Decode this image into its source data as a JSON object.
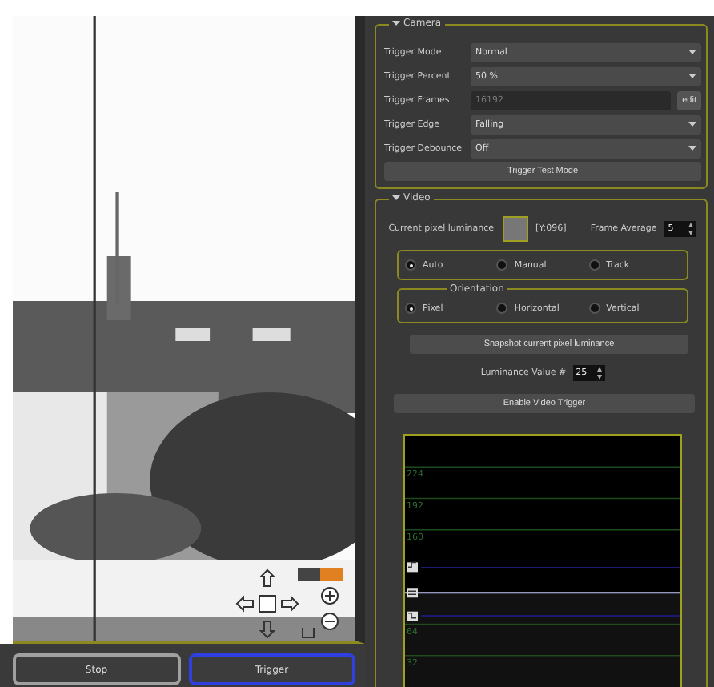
{
  "camera": {
    "title": "Camera",
    "expanded": true,
    "fields": [
      {
        "kind": "combo",
        "label": "Trigger Mode",
        "value": "Normal"
      },
      {
        "kind": "combo",
        "label": "Trigger Percent",
        "value": "50 %"
      },
      {
        "kind": "text",
        "label": "Trigger Frames",
        "value": "16192",
        "disabled": true,
        "button": "edit"
      },
      {
        "kind": "combo",
        "label": "Trigger Edge",
        "value": "Falling"
      },
      {
        "kind": "combo",
        "label": "Trigger Debounce",
        "value": "Off"
      }
    ],
    "test_button": "Trigger Test Mode"
  },
  "video": {
    "title": "Video",
    "expanded": true,
    "luminance_label": "Current pixel luminance",
    "luminance_reading": "[Y:096]",
    "frame_average_label": "Frame Average",
    "frame_average": "5",
    "modes": [
      {
        "label": "Auto",
        "selected": true
      },
      {
        "label": "Manual",
        "selected": false
      },
      {
        "label": "Track",
        "selected": false
      }
    ],
    "orientation": {
      "title": "Orientation",
      "options": [
        {
          "label": "Pixel",
          "selected": true
        },
        {
          "label": "Horizontal",
          "selected": false
        },
        {
          "label": "Vertical",
          "selected": false
        }
      ]
    },
    "snapshot_button": "Snapshot current pixel luminance",
    "luminance_value_label": "Luminance Value #",
    "luminance_value": "25",
    "enable_button": "Enable Video Trigger",
    "chart_data": {
      "type": "area",
      "ylim": [
        0,
        256
      ],
      "yticks": [
        32,
        64,
        160,
        192,
        224
      ],
      "grid": true,
      "series": [
        {
          "color": "#c8c8ff",
          "values": [
            96,
            96,
            96,
            96,
            96,
            96,
            96,
            96,
            96,
            96,
            96
          ]
        }
      ]
    }
  },
  "controls": [
    {
      "label": "Stop",
      "highlighted": false
    },
    {
      "label": "Trigger",
      "highlighted": true
    }
  ]
}
